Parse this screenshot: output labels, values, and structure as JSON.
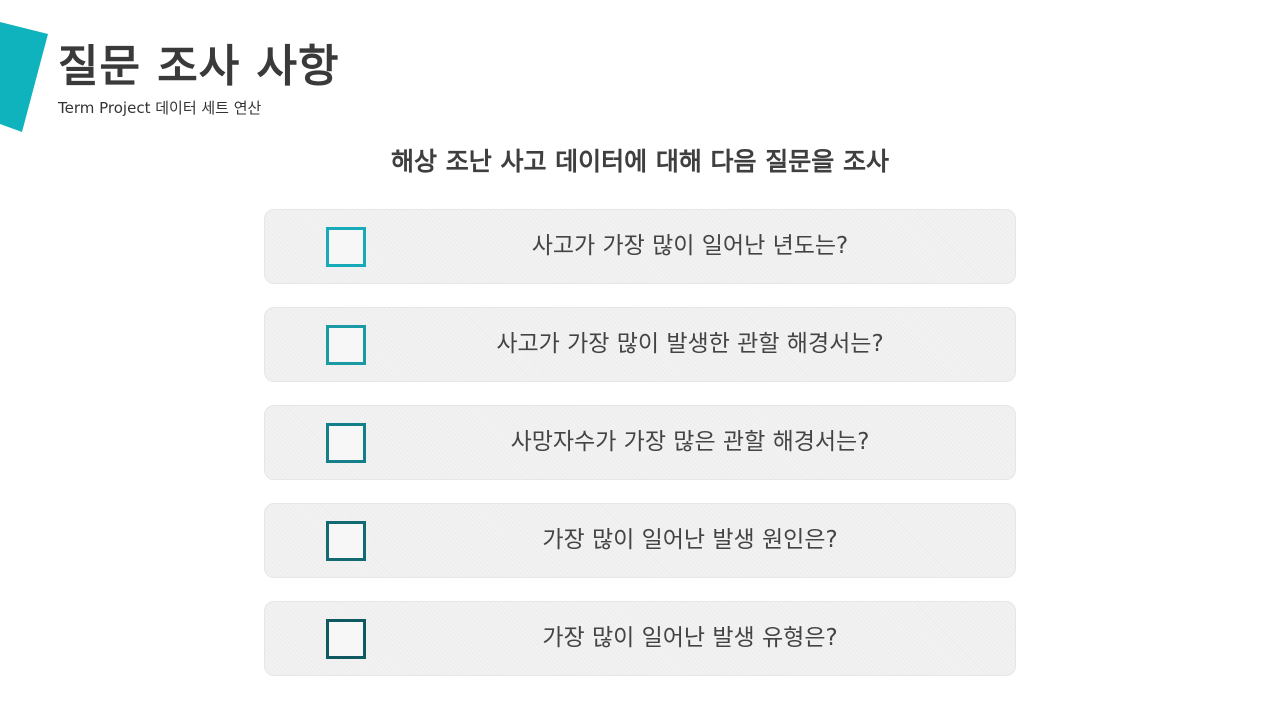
{
  "header": {
    "title": "질문 조사 사항",
    "subtitle": "Term Project 데이터 세트 연산"
  },
  "accent_color": "#0fb3bd",
  "main": {
    "heading": "해상 조난 사고 데이터에 대해 다음 질문을 조사",
    "questions": [
      {
        "label": "사고가 가장 많이 일어난 년도는?",
        "checked": false,
        "color": "#17aab8"
      },
      {
        "label": "사고가 가장 많이 발생한 관할 해경서는?",
        "checked": false,
        "color": "#1a9aa3"
      },
      {
        "label": "사망자수가 가장 많은 관할 해경서는?",
        "checked": false,
        "color": "#147f88"
      },
      {
        "label": "가장 많이 일어난 발생 원인은?",
        "checked": false,
        "color": "#136a72"
      },
      {
        "label": "가장 많이 일어난 발생 유형은?",
        "checked": false,
        "color": "#115960"
      }
    ]
  }
}
